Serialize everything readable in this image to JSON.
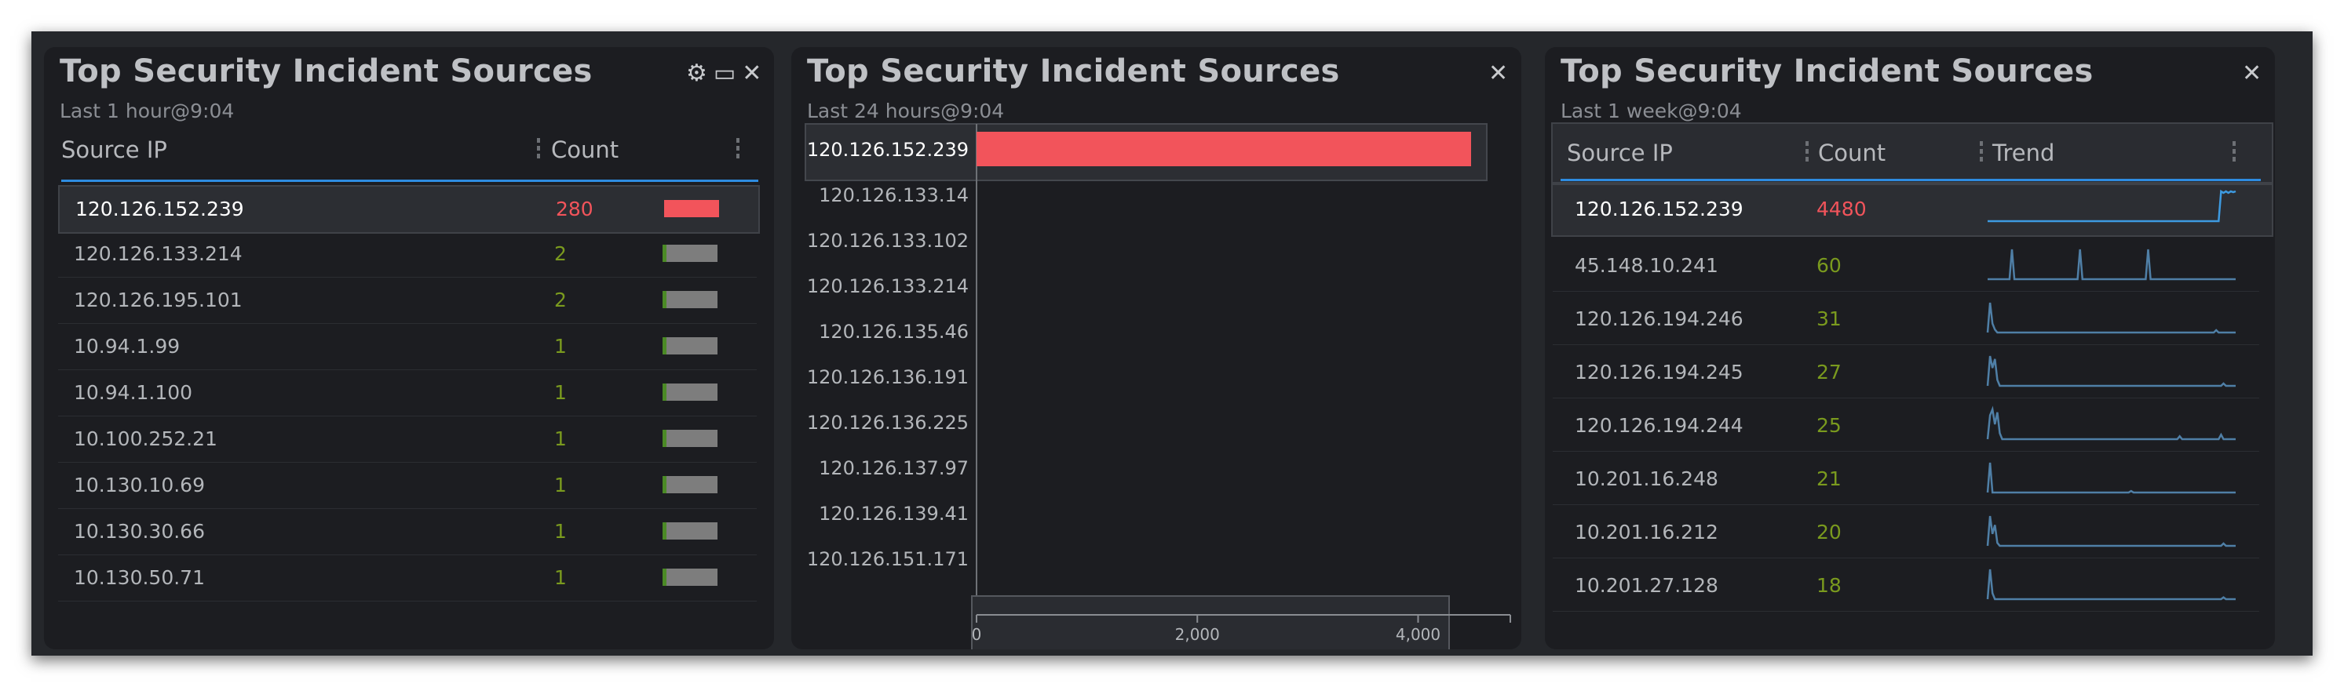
{
  "colors": {
    "accent": "#2e8ce0",
    "bar_highlight": "#f2545b",
    "count_green": "#7a9a1e",
    "bar_grey": "#7d7d7d",
    "trend_line": "#4f7fa6",
    "trend_line_selected": "#3d9ae0"
  },
  "panel1": {
    "title": "Top Security Incident Sources",
    "subtitle": "Last 1 hour@9:04",
    "controls": {
      "settings_icon": "gear-icon",
      "maximize_icon": "window-icon",
      "close_icon": "close-icon",
      "settings_label": "⚙",
      "maximize_label": "▭",
      "close_label": "✕"
    },
    "columns": [
      "Source IP",
      "Count"
    ],
    "rows": [
      {
        "ip": "120.126.152.239",
        "count": "280",
        "bar_fraction": 1.0,
        "selected": true
      },
      {
        "ip": "120.126.133.214",
        "count": "2",
        "bar_fraction": 0.007
      },
      {
        "ip": "120.126.195.101",
        "count": "2",
        "bar_fraction": 0.007
      },
      {
        "ip": "10.94.1.99",
        "count": "1",
        "bar_fraction": 0.004
      },
      {
        "ip": "10.94.1.100",
        "count": "1",
        "bar_fraction": 0.004
      },
      {
        "ip": "10.100.252.21",
        "count": "1",
        "bar_fraction": 0.004
      },
      {
        "ip": "10.130.10.69",
        "count": "1",
        "bar_fraction": 0.004
      },
      {
        "ip": "10.130.30.66",
        "count": "1",
        "bar_fraction": 0.004
      },
      {
        "ip": "10.130.50.71",
        "count": "1",
        "bar_fraction": 0.004
      }
    ]
  },
  "panel2": {
    "title": "Top Security Incident Sources",
    "subtitle": "Last 24 hours@9:04",
    "close_label": "✕",
    "chart_data": {
      "type": "bar",
      "orientation": "horizontal",
      "categories": [
        "120.126.152.239",
        "120.126.133.14",
        "120.126.133.102",
        "120.126.133.214",
        "120.126.135.46",
        "120.126.136.191",
        "120.126.136.225",
        "120.126.137.97",
        "120.126.139.41",
        "120.126.151.171"
      ],
      "values": [
        4480,
        0,
        0,
        0,
        0,
        0,
        0,
        0,
        0,
        0
      ],
      "selected_category": "120.126.152.239",
      "xlim": [
        0,
        4800
      ],
      "xticks": [
        0,
        2000,
        4000
      ],
      "xtick_labels": [
        "0",
        "2,000",
        "4,000"
      ],
      "grid": false,
      "legend": "none"
    }
  },
  "panel3": {
    "title": "Top Security Incident Sources",
    "subtitle": "Last 1 week@9:04",
    "close_label": "✕",
    "columns": [
      "Source IP",
      "Count",
      "Trend"
    ],
    "rows": [
      {
        "ip": "120.126.152.239",
        "count": "4480",
        "selected": true,
        "trend": [
          0,
          0,
          0,
          0,
          0,
          0,
          0,
          0,
          0,
          0,
          0,
          0,
          0,
          0,
          0,
          0,
          0,
          0,
          0,
          0,
          0,
          0,
          0,
          0,
          0,
          0,
          0,
          0,
          0,
          0,
          0,
          0,
          0,
          0,
          0,
          0,
          0,
          0,
          0,
          0,
          0,
          0,
          0,
          0,
          0,
          0,
          0,
          0,
          0,
          0,
          0,
          0,
          0,
          0,
          0,
          0,
          0,
          0,
          0,
          0,
          0,
          0,
          0,
          0,
          0,
          0,
          0,
          0,
          0,
          0,
          0,
          0,
          0,
          0,
          0,
          0,
          0,
          0,
          0,
          0,
          0,
          0,
          0,
          0,
          0,
          0,
          0,
          0,
          0,
          0,
          0,
          0,
          0,
          0,
          0,
          0,
          1,
          0.95,
          1,
          0.95,
          1,
          0.97,
          1
        ]
      },
      {
        "ip": "45.148.10.241",
        "count": "60",
        "trend": [
          0,
          0,
          0,
          0,
          0,
          0,
          0,
          0,
          0,
          0,
          1,
          0,
          0,
          0,
          0,
          0,
          0,
          0,
          0,
          0,
          0,
          0,
          0,
          0,
          0,
          0,
          0,
          0,
          0,
          0,
          0,
          0,
          0,
          0,
          0,
          0,
          0,
          0,
          1,
          0,
          0,
          0,
          0,
          0,
          0,
          0,
          0,
          0,
          0,
          0,
          0,
          0,
          0,
          0,
          0,
          0,
          0,
          0,
          0,
          0,
          0,
          0,
          0,
          0,
          0,
          0,
          1,
          0,
          0,
          0,
          0,
          0,
          0,
          0,
          0,
          0,
          0,
          0,
          0,
          0,
          0,
          0,
          0,
          0,
          0,
          0,
          0,
          0,
          0,
          0,
          0,
          0,
          0,
          0,
          0,
          0,
          0,
          0,
          0,
          0,
          0,
          0,
          0
        ]
      },
      {
        "ip": "120.126.194.246",
        "count": "31",
        "trend": [
          0,
          1,
          0.3,
          0.1,
          0,
          0,
          0,
          0,
          0,
          0,
          0,
          0,
          0,
          0,
          0,
          0,
          0,
          0,
          0,
          0,
          0,
          0,
          0,
          0,
          0,
          0,
          0,
          0,
          0,
          0,
          0,
          0,
          0,
          0,
          0,
          0,
          0,
          0,
          0,
          0,
          0,
          0,
          0,
          0,
          0,
          0,
          0,
          0,
          0,
          0,
          0,
          0,
          0,
          0,
          0,
          0,
          0,
          0,
          0,
          0,
          0,
          0,
          0,
          0,
          0,
          0,
          0,
          0,
          0,
          0,
          0,
          0,
          0,
          0,
          0,
          0,
          0,
          0,
          0,
          0,
          0,
          0,
          0,
          0,
          0,
          0,
          0,
          0,
          0,
          0,
          0,
          0,
          0,
          0,
          0.08,
          0,
          0,
          0,
          0,
          0,
          0,
          0,
          0
        ]
      },
      {
        "ip": "120.126.194.245",
        "count": "27",
        "trend": [
          0,
          1,
          0.6,
          0.9,
          0.2,
          0,
          0,
          0,
          0,
          0,
          0,
          0,
          0,
          0,
          0,
          0,
          0,
          0,
          0,
          0,
          0,
          0,
          0,
          0,
          0,
          0,
          0,
          0,
          0,
          0,
          0,
          0,
          0,
          0,
          0,
          0,
          0,
          0,
          0,
          0,
          0,
          0,
          0,
          0,
          0,
          0,
          0,
          0,
          0,
          0,
          0,
          0,
          0,
          0,
          0,
          0,
          0,
          0,
          0,
          0,
          0,
          0,
          0,
          0,
          0,
          0,
          0,
          0,
          0,
          0,
          0,
          0,
          0,
          0,
          0,
          0,
          0,
          0,
          0,
          0,
          0,
          0,
          0,
          0,
          0,
          0,
          0,
          0,
          0,
          0,
          0,
          0,
          0,
          0,
          0,
          0,
          0,
          0.08,
          0,
          0,
          0,
          0,
          0
        ]
      },
      {
        "ip": "120.126.194.244",
        "count": "25",
        "trend": [
          0,
          0.8,
          1,
          0.5,
          0.9,
          0.2,
          0,
          0,
          0,
          0,
          0,
          0,
          0,
          0,
          0,
          0,
          0,
          0,
          0,
          0,
          0,
          0,
          0,
          0,
          0,
          0,
          0,
          0,
          0,
          0,
          0,
          0,
          0,
          0,
          0,
          0,
          0,
          0,
          0,
          0,
          0,
          0,
          0,
          0,
          0,
          0,
          0,
          0,
          0,
          0,
          0,
          0,
          0,
          0,
          0,
          0,
          0,
          0,
          0,
          0,
          0,
          0,
          0,
          0,
          0,
          0,
          0,
          0,
          0,
          0,
          0,
          0,
          0,
          0,
          0,
          0,
          0,
          0,
          0,
          0.1,
          0,
          0,
          0,
          0,
          0,
          0,
          0,
          0,
          0,
          0,
          0,
          0,
          0,
          0,
          0,
          0,
          0.15,
          0,
          0,
          0,
          0,
          0,
          0
        ]
      },
      {
        "ip": "10.201.16.248",
        "count": "21",
        "trend": [
          0,
          1,
          0,
          0,
          0,
          0,
          0,
          0,
          0,
          0,
          0,
          0,
          0,
          0,
          0,
          0,
          0,
          0,
          0,
          0,
          0,
          0,
          0,
          0,
          0,
          0,
          0,
          0,
          0,
          0,
          0,
          0,
          0,
          0,
          0,
          0,
          0,
          0,
          0,
          0,
          0,
          0,
          0,
          0,
          0,
          0,
          0,
          0,
          0,
          0,
          0,
          0,
          0,
          0,
          0,
          0,
          0,
          0,
          0,
          0.05,
          0,
          0,
          0,
          0,
          0,
          0,
          0,
          0,
          0,
          0,
          0,
          0,
          0,
          0,
          0,
          0,
          0,
          0,
          0,
          0,
          0,
          0,
          0,
          0,
          0,
          0,
          0,
          0,
          0,
          0,
          0,
          0,
          0,
          0,
          0,
          0,
          0,
          0,
          0,
          0,
          0,
          0,
          0
        ]
      },
      {
        "ip": "10.201.16.212",
        "count": "20",
        "trend": [
          0,
          1,
          0.4,
          0.7,
          0.1,
          0,
          0,
          0,
          0,
          0,
          0,
          0,
          0,
          0,
          0,
          0,
          0,
          0,
          0,
          0,
          0,
          0,
          0,
          0,
          0,
          0,
          0,
          0,
          0,
          0,
          0,
          0,
          0,
          0,
          0,
          0,
          0,
          0,
          0,
          0,
          0,
          0,
          0,
          0,
          0,
          0,
          0,
          0,
          0,
          0,
          0,
          0,
          0,
          0,
          0,
          0,
          0,
          0,
          0,
          0,
          0,
          0,
          0,
          0,
          0,
          0,
          0,
          0,
          0,
          0,
          0,
          0,
          0,
          0,
          0,
          0,
          0,
          0,
          0,
          0,
          0,
          0,
          0,
          0,
          0,
          0,
          0,
          0,
          0,
          0,
          0,
          0,
          0,
          0,
          0,
          0,
          0,
          0.08,
          0,
          0,
          0,
          0,
          0
        ]
      },
      {
        "ip": "10.201.27.128",
        "count": "18",
        "trend": [
          0,
          1,
          0.2,
          0,
          0,
          0,
          0,
          0,
          0,
          0,
          0,
          0,
          0,
          0,
          0,
          0,
          0,
          0,
          0,
          0,
          0,
          0,
          0,
          0,
          0,
          0,
          0,
          0,
          0,
          0,
          0,
          0,
          0,
          0,
          0,
          0,
          0,
          0,
          0,
          0,
          0,
          0,
          0,
          0,
          0,
          0,
          0,
          0,
          0,
          0,
          0,
          0,
          0,
          0,
          0,
          0,
          0,
          0,
          0,
          0,
          0,
          0,
          0,
          0,
          0,
          0,
          0,
          0,
          0,
          0,
          0,
          0,
          0,
          0,
          0,
          0,
          0,
          0,
          0,
          0,
          0,
          0,
          0,
          0,
          0,
          0,
          0,
          0,
          0,
          0,
          0,
          0,
          0,
          0,
          0,
          0,
          0,
          0.06,
          0,
          0,
          0,
          0,
          0
        ]
      }
    ]
  }
}
